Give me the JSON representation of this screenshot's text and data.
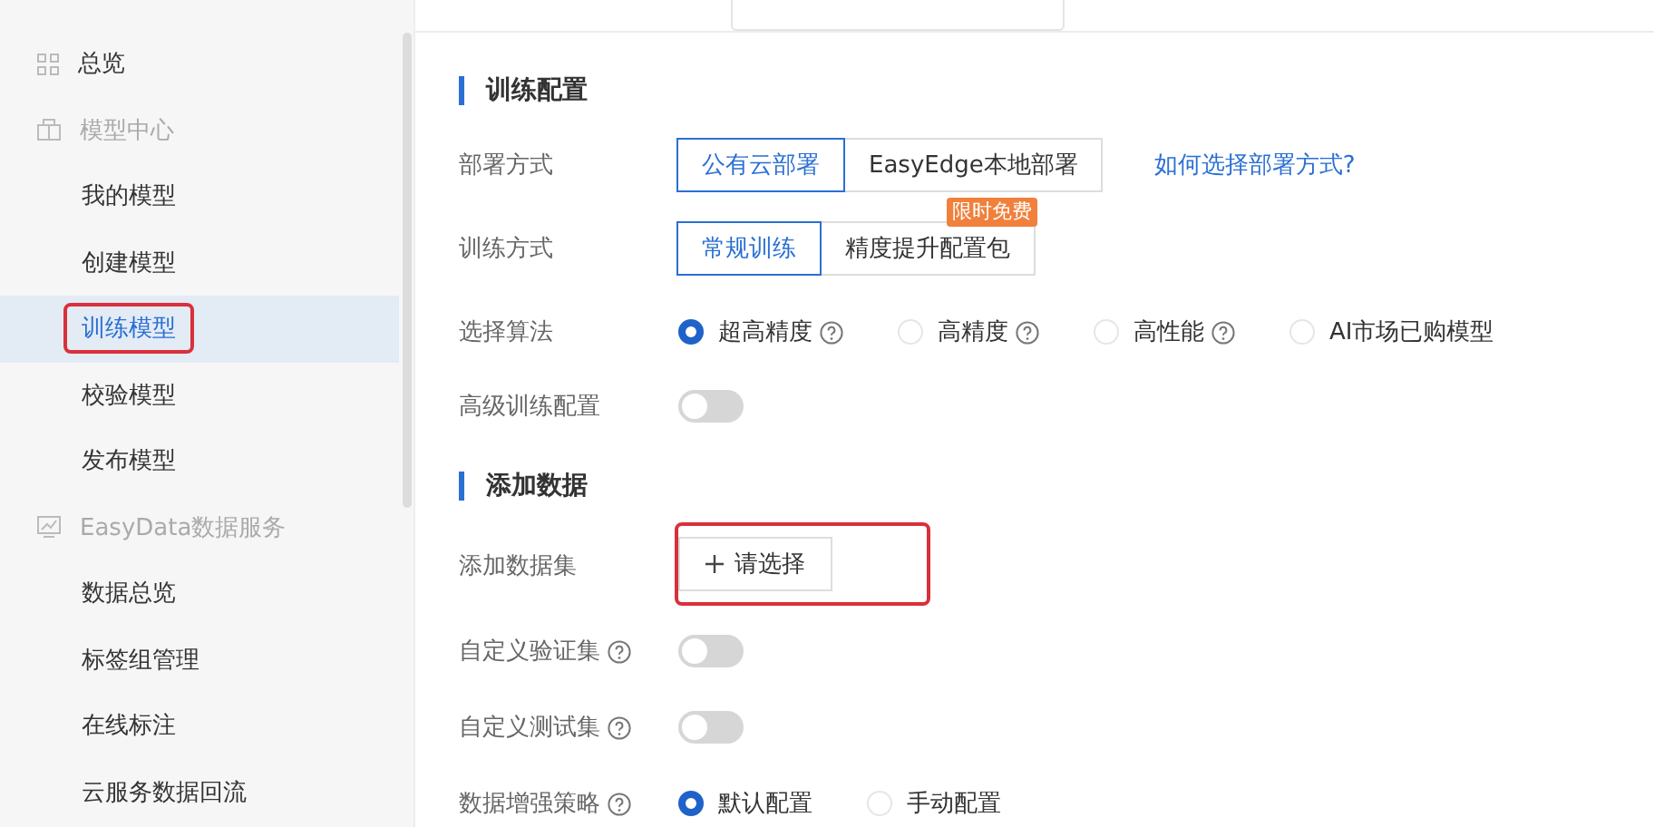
{
  "sidebar": {
    "items": [
      {
        "label": "总览",
        "kind": "link"
      },
      {
        "label": "模型中心",
        "kind": "group",
        "children": [
          {
            "label": "我的模型",
            "selected": false,
            "highlighted": false
          },
          {
            "label": "创建模型",
            "selected": false,
            "highlighted": false
          },
          {
            "label": "训练模型",
            "selected": true,
            "highlighted": true
          },
          {
            "label": "校验模型",
            "selected": false,
            "highlighted": false
          },
          {
            "label": "发布模型",
            "selected": false,
            "highlighted": false
          }
        ]
      },
      {
        "label": "EasyData数据服务",
        "kind": "group",
        "children": [
          {
            "label": "数据总览",
            "selected": false,
            "highlighted": false
          },
          {
            "label": "标签组管理",
            "selected": false,
            "highlighted": false
          },
          {
            "label": "在线标注",
            "selected": false,
            "highlighted": false
          },
          {
            "label": "云服务数据回流",
            "selected": false,
            "highlighted": false
          }
        ]
      }
    ]
  },
  "sections": [
    {
      "title": "训练配置",
      "fields": [
        {
          "label": "部署方式",
          "kind": "segmented",
          "options": [
            {
              "label": "公有云部署",
              "selected": true
            },
            {
              "label": "EasyEdge本地部署",
              "selected": false
            }
          ],
          "link": "如何选择部署方式?"
        },
        {
          "label": "训练方式",
          "kind": "segmented",
          "options": [
            {
              "label": "常规训练",
              "selected": true
            },
            {
              "label": "精度提升配置包",
              "selected": false,
              "badge": "限时免费"
            }
          ]
        },
        {
          "label": "选择算法",
          "kind": "radio",
          "options": [
            {
              "label": "超高精度",
              "selected": true,
              "help": true
            },
            {
              "label": "高精度",
              "selected": false,
              "help": true
            },
            {
              "label": "高性能",
              "selected": false,
              "help": true
            },
            {
              "label": "AI市场已购模型",
              "selected": false
            }
          ]
        },
        {
          "label": "高级训练配置",
          "kind": "switch",
          "on": false
        }
      ]
    },
    {
      "title": "添加数据",
      "fields": [
        {
          "label": "添加数据集",
          "kind": "button",
          "button": "请选择",
          "highlighted": true
        },
        {
          "label": "自定义验证集",
          "help": true,
          "kind": "switch",
          "on": false
        },
        {
          "label": "自定义测试集",
          "help": true,
          "kind": "switch",
          "on": false
        },
        {
          "label": "数据增强策略",
          "help": true,
          "kind": "radio",
          "options": [
            {
              "label": "默认配置",
              "selected": true
            },
            {
              "label": "手动配置",
              "selected": false
            }
          ]
        }
      ]
    }
  ]
}
